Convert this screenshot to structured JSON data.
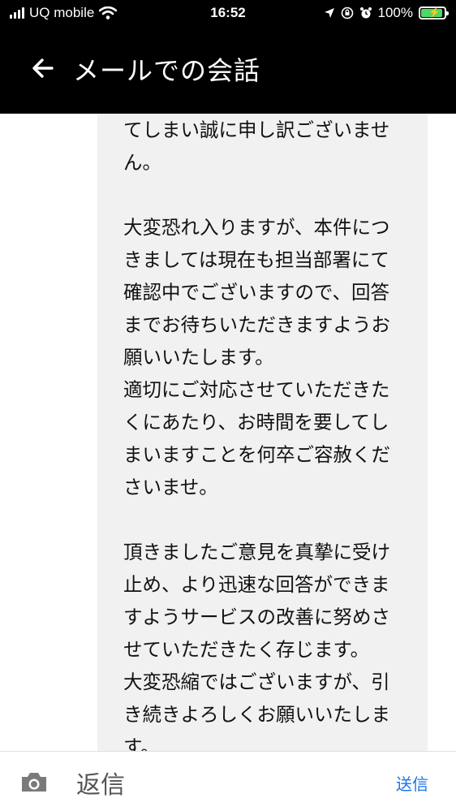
{
  "status_bar": {
    "carrier": "UQ mobile",
    "time": "16:52",
    "battery_percent": "100%",
    "icons": [
      "signal-icon",
      "wifi-icon",
      "location-icon",
      "rotation-lock-icon",
      "alarm-icon",
      "battery-charging-icon"
    ],
    "battery_color": "#4cd964"
  },
  "header": {
    "title": "メールでの会話",
    "back_icon": "back-arrow-icon",
    "background": "#000000"
  },
  "message": {
    "paragraphs": [
      [
        "てしまい誠に申し訳ございませ",
        "ん。"
      ],
      [
        "大変恐れ入りますが、本件につ",
        "きましては現在も担当部署にて",
        "確認中でございますので、回答",
        "までお待ちいただきますようお",
        "願いいたします。",
        "適切にご対応させていただきた",
        "くにあたり、お時間を要してし",
        "まいますことを何卒ご容赦くだ",
        "さいませ。"
      ],
      [
        "頂きましたご意見を真摯に受け",
        "止め、より迅速な回答ができま",
        "すようサービスの改善に努めさ",
        "せていただきたく存じます。",
        "大変恐縮ではございますが、引",
        "き続きよろしくお願いいたしま",
        "す。"
      ]
    ],
    "bubble_color": "#f1f1f1"
  },
  "reply_bar": {
    "placeholder": "返信",
    "send_label": "送信",
    "camera_icon": "camera-icon",
    "accent": "#1a73e8"
  }
}
